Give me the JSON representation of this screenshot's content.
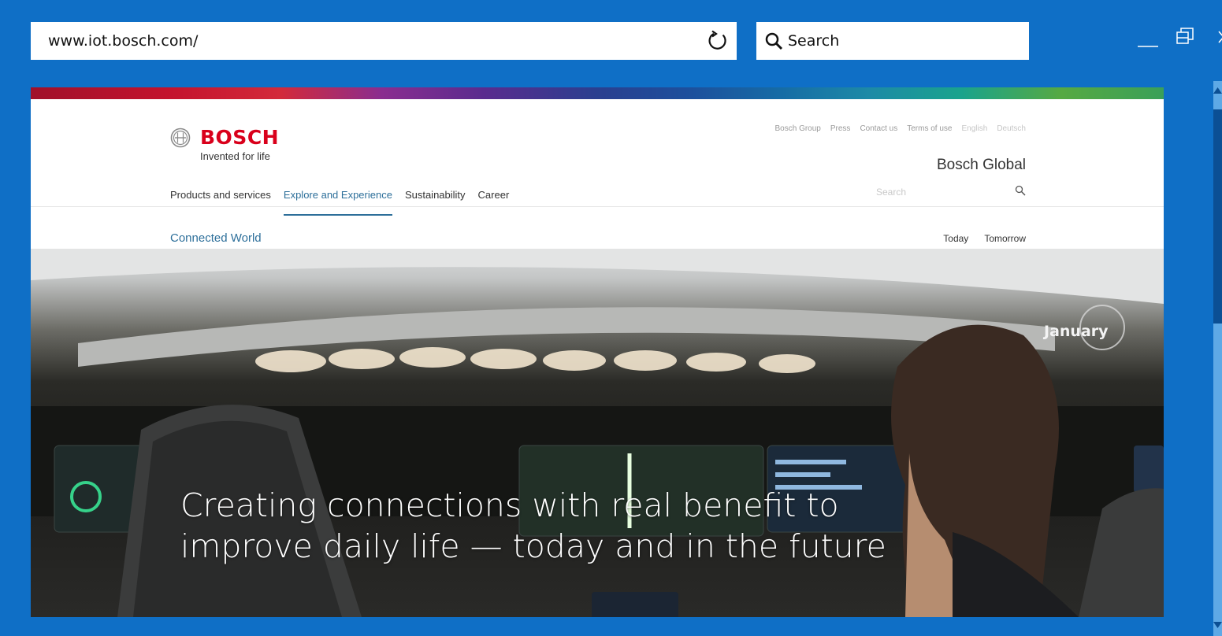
{
  "browser": {
    "address": "www.iot.bosch.com/",
    "search_placeholder": "Search"
  },
  "page": {
    "brand": "BOSCH",
    "tagline": "Invented for life",
    "meta_nav": [
      "Bosch Group",
      "Press",
      "Contact us",
      "Terms of use",
      "English",
      "Deutsch"
    ],
    "site_title": "Bosch Global",
    "main_nav": [
      "Products and services",
      "Explore and Experience",
      "Sustainability",
      "Career"
    ],
    "site_search_placeholder": "Search",
    "sub_nav": "Connected World",
    "time_tabs": [
      "Today",
      "Tomorrow"
    ],
    "hero": {
      "badge": "January",
      "headline": "Creating connections with real benefit to\nimprove daily life — today and in the future"
    }
  },
  "colors": {
    "chrome": "#0f6fc6",
    "brand_red": "#d9001b",
    "link_blue": "#2d6f9a"
  }
}
